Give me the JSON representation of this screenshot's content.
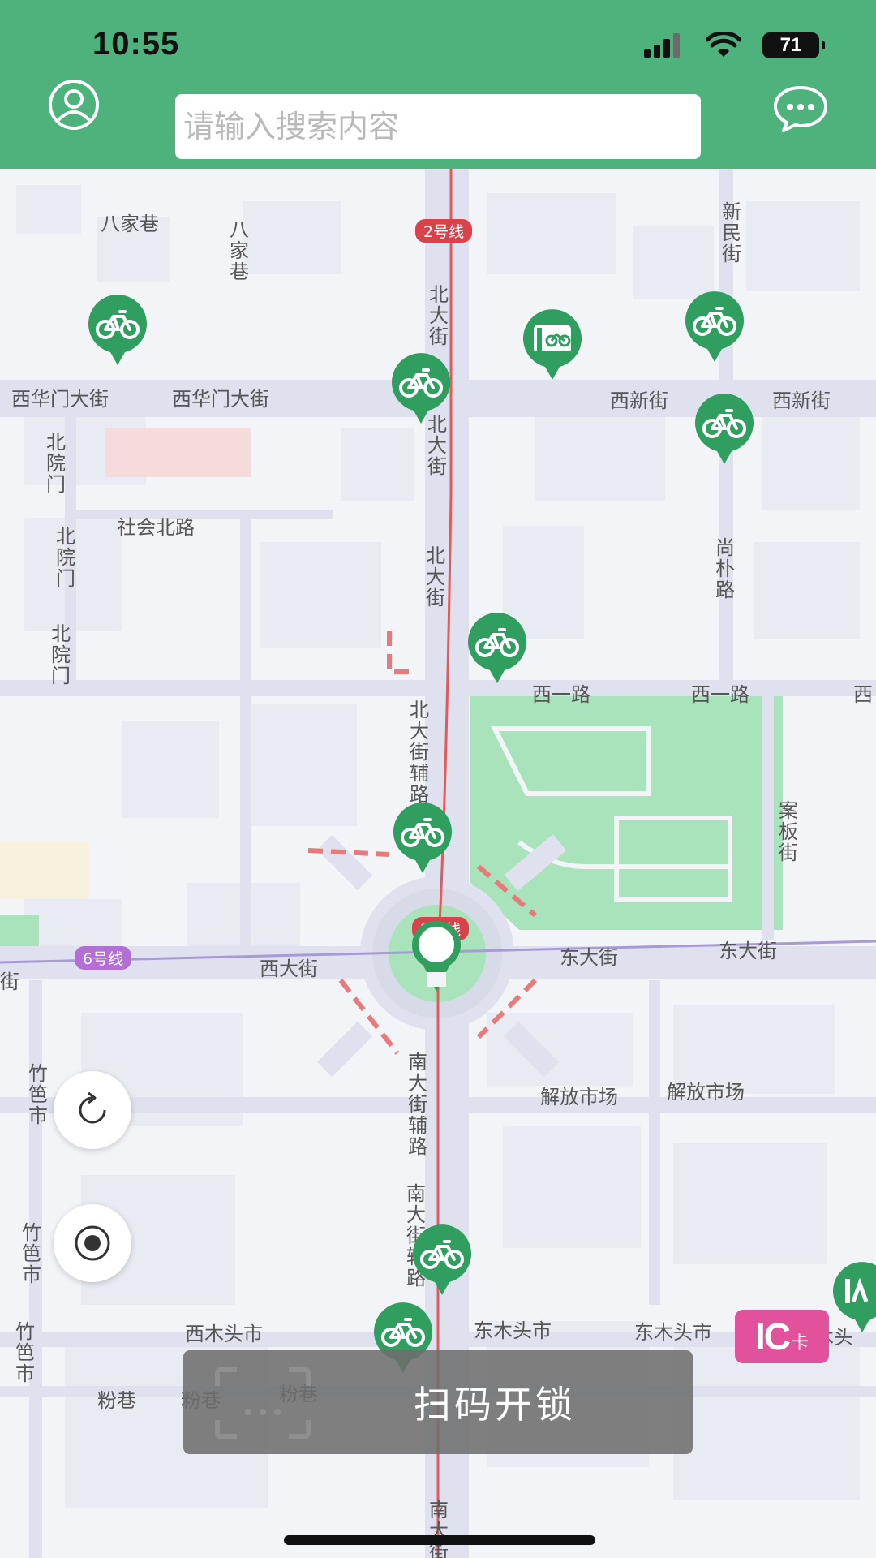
{
  "status_bar": {
    "time": "10:55",
    "battery": "71",
    "icons": [
      "signal-icon",
      "wifi-icon",
      "battery-icon"
    ]
  },
  "header": {
    "user_icon": "user-icon",
    "search_placeholder": "请输入搜索内容",
    "message_icon": "message-icon"
  },
  "map": {
    "street_labels": {
      "bajiaxiang_h": "八家巷",
      "bajiaxiang_v": "八家巷",
      "xinmin": "新民街",
      "xihuamen_1": "西华门大街",
      "xihuamen_2": "西华门大街",
      "xixin_1": "西新街",
      "xixin_2": "西新街",
      "beiyuanmen_1": "北院门",
      "beiyuanmen_2": "北院门",
      "beiyuanmen_3": "北院门",
      "shehui_bei": "社会北路",
      "beidajie_1": "北大街",
      "beidajie_2": "北大街",
      "beidajie_3": "北大街",
      "beidajie_fu": "北大街辅路",
      "shangpu": "尚朴路",
      "xiyi_1": "西一路",
      "xiyi_2": "西一路",
      "xiyi_3": "西",
      "anban": "案板街",
      "xidajie": "西大街",
      "dongdajie_1": "东大街",
      "dongdajie_2": "东大街",
      "zhudi_1": "竹笆市",
      "zhudi_2": "竹笆市",
      "zhudi_3": "竹笆市",
      "jiefang_1": "解放市场",
      "jiefang_2": "解放市场",
      "nandajie_fu": "南大街辅路",
      "nandajie_1": "南大街辅路",
      "ximutou": "西木头市",
      "dongmutou_1": "东木头市",
      "dongmutou_2": "东木头市",
      "dongmutou_3": "东木头",
      "fenxiang_1": "粉巷",
      "fenxiang_2": "粉巷",
      "fenxiang_3": "粉巷",
      "nandajie_bottom": "南大街",
      "edge_left": "街"
    },
    "metro_labels": {
      "line2_top": "2号线",
      "line2_center": "2号线",
      "line6": "6号线"
    },
    "ic_card": {
      "ic": "IC",
      "ka": "卡"
    }
  },
  "controls": {
    "refresh_icon": "refresh-icon",
    "locate_icon": "locate-icon"
  },
  "scan_button": {
    "label": "扫码开锁",
    "icon": "scan-icon"
  },
  "colors": {
    "header_green": "#4db27b",
    "bike_marker": "#2f9e5f",
    "metro_red": "#d9424b",
    "metro_purple": "#b36fd6",
    "ic_pink": "#e2519c"
  }
}
